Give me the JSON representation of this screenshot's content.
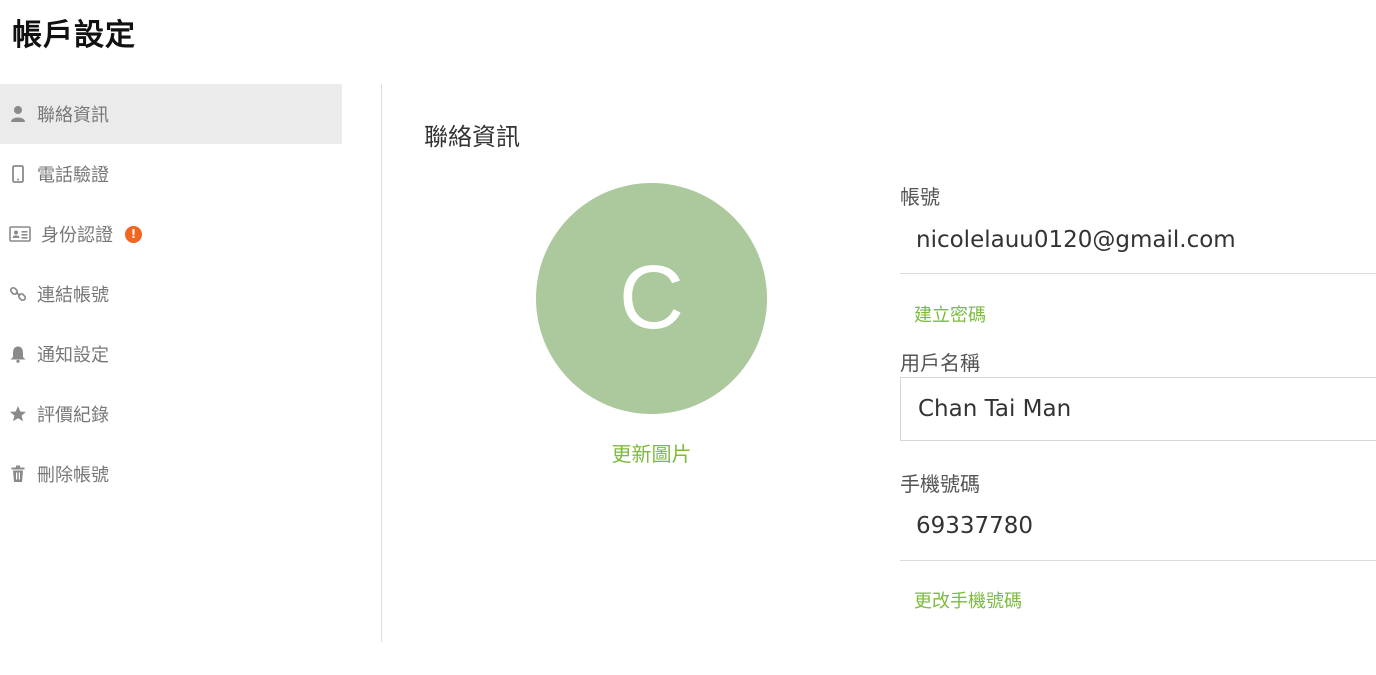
{
  "page": {
    "title": "帳戶設定"
  },
  "sidebar": {
    "items": [
      {
        "label": "聯絡資訊",
        "icon": "user-icon",
        "active": true
      },
      {
        "label": "電話驗證",
        "icon": "phone-icon"
      },
      {
        "label": "身份認證",
        "icon": "id-card-icon",
        "badge": "!"
      },
      {
        "label": "連結帳號",
        "icon": "link-icon"
      },
      {
        "label": "通知設定",
        "icon": "bell-icon"
      },
      {
        "label": "評價紀錄",
        "icon": "star-icon"
      },
      {
        "label": "刪除帳號",
        "icon": "trash-icon"
      }
    ]
  },
  "main": {
    "section_title": "聯絡資訊",
    "avatar": {
      "initial": "C",
      "color": "#abc99c"
    },
    "update_photo_label": "更新圖片",
    "account": {
      "label": "帳號",
      "value": "nicolelauu0120@gmail.com",
      "action": "建立密碼"
    },
    "username": {
      "label": "用戶名稱",
      "value": "Chan Tai Man"
    },
    "phone": {
      "label": "手機號碼",
      "value": "69337780",
      "action": "更改手機號碼"
    }
  },
  "colors": {
    "accent_green": "#7cbb3f",
    "alert_orange": "#f26522",
    "active_bg": "#ebebeb"
  }
}
